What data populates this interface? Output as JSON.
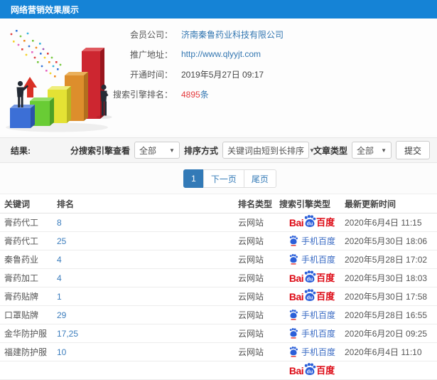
{
  "titlebar": {
    "title": "网络营销效果展示"
  },
  "member": {
    "company_label": "会员公司：",
    "company": "济南秦鲁药业科技有限公司",
    "url_label": "推广地址：",
    "url": "http://www.qlyyjt.com",
    "opened_label": "开通时间：",
    "opened": "2019年5月27日 09:17",
    "rank_label": "搜索引擎排名：",
    "rank_count": "4895",
    "rank_unit": "条"
  },
  "filterbar": {
    "result_label": "结果:",
    "engine_label": "分搜索引擎查看",
    "engine_value": "全部",
    "sort_label": "排序方式",
    "sort_value": "关键词由短到长排序",
    "type_label": "文章类型",
    "type_value": "全部",
    "submit": "提交"
  },
  "pagination": {
    "current": "1",
    "next": "下一页",
    "last": "尾页"
  },
  "table": {
    "headers": {
      "keyword": "关键词",
      "rank": "排名",
      "rank_type": "排名类型",
      "engine": "搜索引擎类型",
      "updated": "最新更新时间"
    },
    "rows": [
      {
        "keyword": "膏药代工",
        "rank": "8",
        "rank_type": "云网站",
        "engine": "baidu-pc",
        "updated": "2020年6月4日 11:15"
      },
      {
        "keyword": "膏药代工",
        "rank": "25",
        "rank_type": "云网站",
        "engine": "baidu-mobile",
        "updated": "2020年5月30日 18:06"
      },
      {
        "keyword": "秦鲁药业",
        "rank": "4",
        "rank_type": "云网站",
        "engine": "baidu-mobile",
        "updated": "2020年5月28日 17:02"
      },
      {
        "keyword": "膏药加工",
        "rank": "4",
        "rank_type": "云网站",
        "engine": "baidu-pc",
        "updated": "2020年5月30日 18:03"
      },
      {
        "keyword": "膏药贴牌",
        "rank": "1",
        "rank_type": "云网站",
        "engine": "baidu-pc",
        "updated": "2020年5月30日 17:58"
      },
      {
        "keyword": "口罩贴牌",
        "rank": "29",
        "rank_type": "云网站",
        "engine": "baidu-mobile",
        "updated": "2020年5月28日 16:55"
      },
      {
        "keyword": "金华防护服",
        "rank": "17,25",
        "rank_type": "云网站",
        "engine": "baidu-mobile",
        "updated": "2020年6月20日 09:25"
      },
      {
        "keyword": "福建防护服",
        "rank": "10",
        "rank_type": "云网站",
        "engine": "baidu-mobile",
        "updated": "2020年6月4日 11:10"
      },
      {
        "keyword": "",
        "rank": "",
        "rank_type": "",
        "engine": "baidu-pc",
        "updated": ""
      }
    ]
  },
  "baidu": {
    "pc_bai": "Bai",
    "pc_du": "du",
    "pc_cn": "百度",
    "mobile_label": "手机百度"
  },
  "colors": {
    "topbar": "#1583d6",
    "link_blue": "#3276b1",
    "count_red": "#e4393c",
    "baidu_red": "#dd0a15",
    "baidu_blue": "#2b5fd9",
    "pagination_active": "#337ab7"
  }
}
